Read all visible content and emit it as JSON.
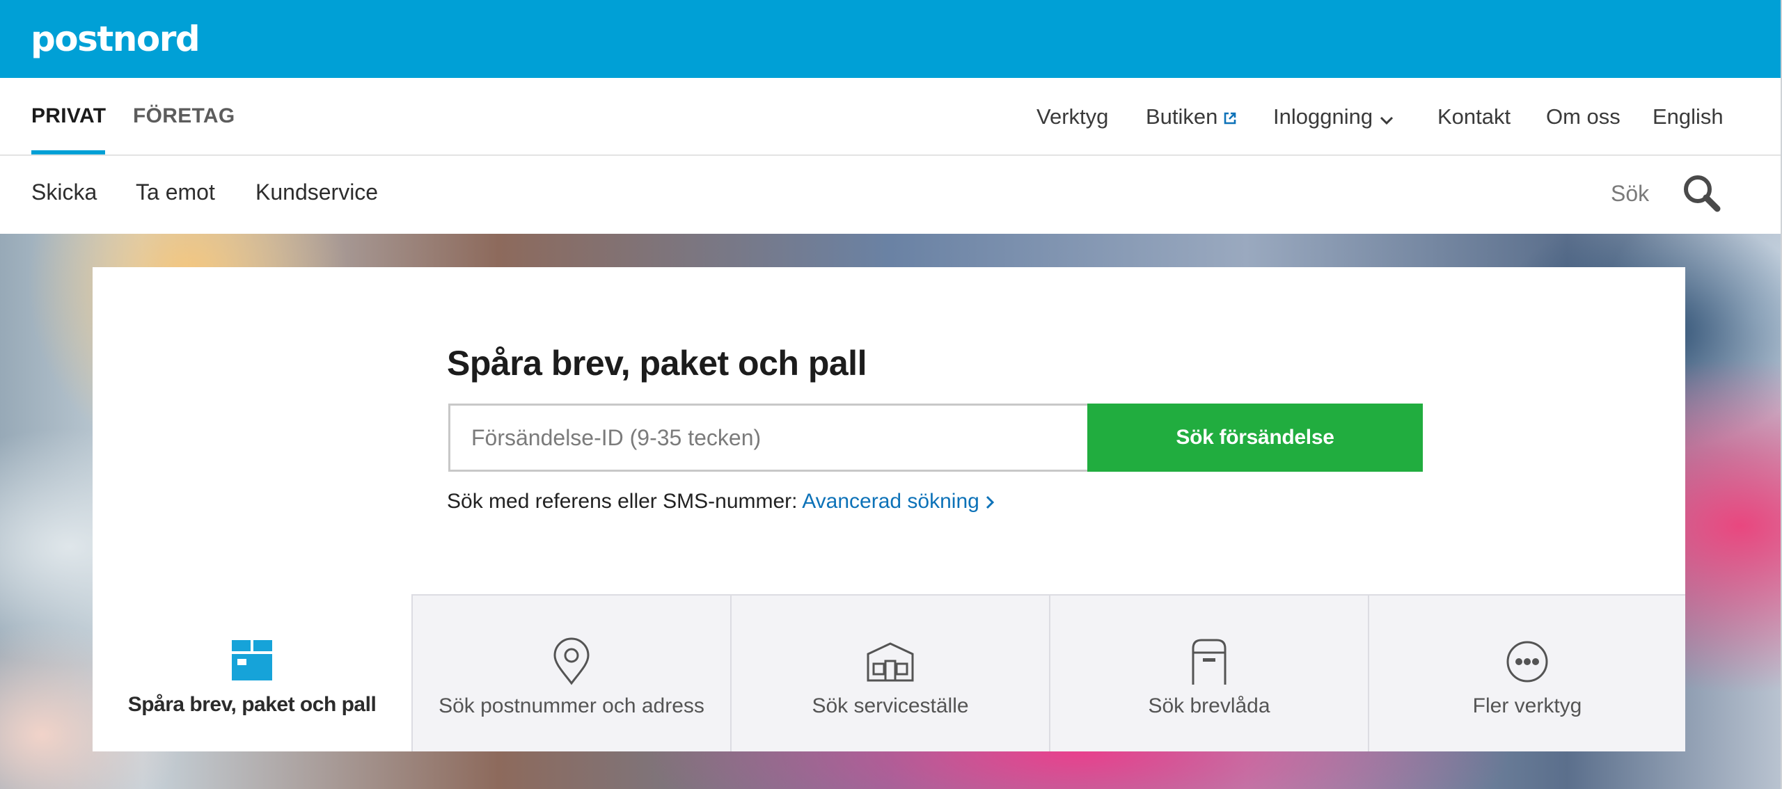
{
  "brand": {
    "logo_text": "postnord",
    "bar_color": "#00a0d6"
  },
  "segments": [
    {
      "label": "PRIVAT",
      "active": true
    },
    {
      "label": "FÖRETAG",
      "active": false
    }
  ],
  "top_links": {
    "verktyg": "Verktyg",
    "butiken": "Butiken",
    "inloggning": "Inloggning",
    "kontakt": "Kontakt",
    "om_oss": "Om oss",
    "english": "English"
  },
  "sub_nav": {
    "skicka": "Skicka",
    "ta_emot": "Ta emot",
    "kundservice": "Kundservice",
    "search_label": "Sök"
  },
  "tracking": {
    "title": "Spåra brev, paket och pall",
    "input_placeholder": "Försändelse-ID (9-35 tecken)",
    "input_value": "",
    "submit_label": "Sök försändelse",
    "hint_text": "Sök med referens eller SMS-nummer:",
    "advanced_link": "Avancerad sökning"
  },
  "tool_tabs": [
    {
      "label": "Spåra brev, paket och pall",
      "icon": "package-icon",
      "active": true
    },
    {
      "label": "Sök postnummer och adress",
      "icon": "location-pin-icon",
      "active": false
    },
    {
      "label": "Sök serviceställe",
      "icon": "service-point-icon",
      "active": false
    },
    {
      "label": "Sök brevlåda",
      "icon": "mailbox-icon",
      "active": false
    },
    {
      "label": "Fler verktyg",
      "icon": "more-icon",
      "active": false
    }
  ],
  "colors": {
    "accent": "#00a0d6",
    "cta_green": "#21ad3f",
    "link_blue": "#0d72b8",
    "tab_inactive_bg": "#f3f3f6"
  }
}
